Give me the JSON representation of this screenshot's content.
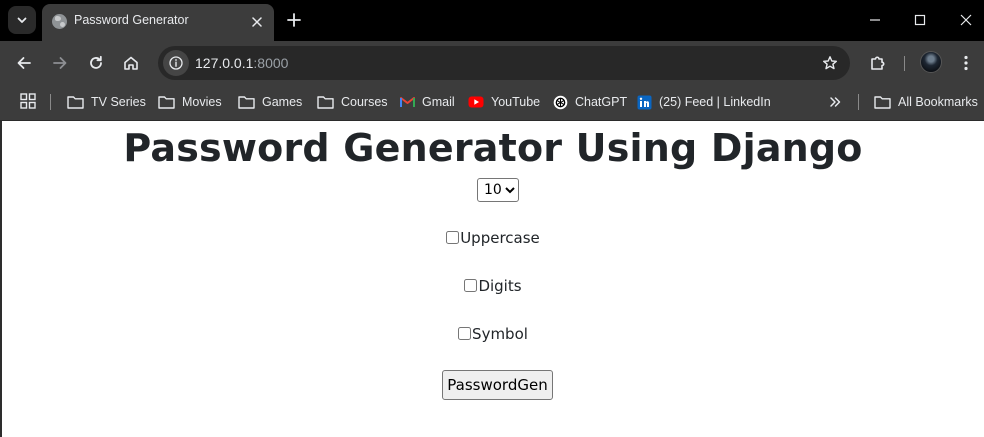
{
  "browser": {
    "tab": {
      "title": "Password Generator",
      "favicon": "globe-icon"
    },
    "window_controls": [
      "minimize-icon",
      "maximize-icon",
      "close-icon"
    ],
    "address_bar": {
      "host": "127.0.0.1",
      "port": ":8000"
    },
    "bookmarks": [
      {
        "label": "TV Series",
        "icon": "folder-icon"
      },
      {
        "label": "Movies",
        "icon": "folder-icon"
      },
      {
        "label": "Games",
        "icon": "folder-icon"
      },
      {
        "label": "Courses",
        "icon": "folder-icon"
      },
      {
        "label": "Gmail",
        "icon": "gmail-icon"
      },
      {
        "label": "YouTube",
        "icon": "youtube-icon"
      },
      {
        "label": "ChatGPT",
        "icon": "chatgpt-icon"
      },
      {
        "label": "(25) Feed | LinkedIn",
        "icon": "linkedin-icon"
      }
    ],
    "all_bookmarks": {
      "label": "All Bookmarks",
      "icon": "folder-icon"
    },
    "colors": {
      "frame": "#000000",
      "toolbar": "#3c3c3c",
      "omnibox": "#282828",
      "text": "#e8eaed",
      "muted": "#9aa0a6"
    }
  },
  "page": {
    "title": "Password Generator Using Django",
    "length": {
      "selected": "10",
      "options": [
        "10"
      ]
    },
    "options": [
      {
        "label": "Uppercase",
        "checked": false
      },
      {
        "label": "Digits",
        "checked": false
      },
      {
        "label": "Symbol",
        "checked": false
      }
    ],
    "submit_label": "PasswordGen",
    "colors": {
      "heading": "#212529",
      "background": "#ffffff"
    }
  }
}
